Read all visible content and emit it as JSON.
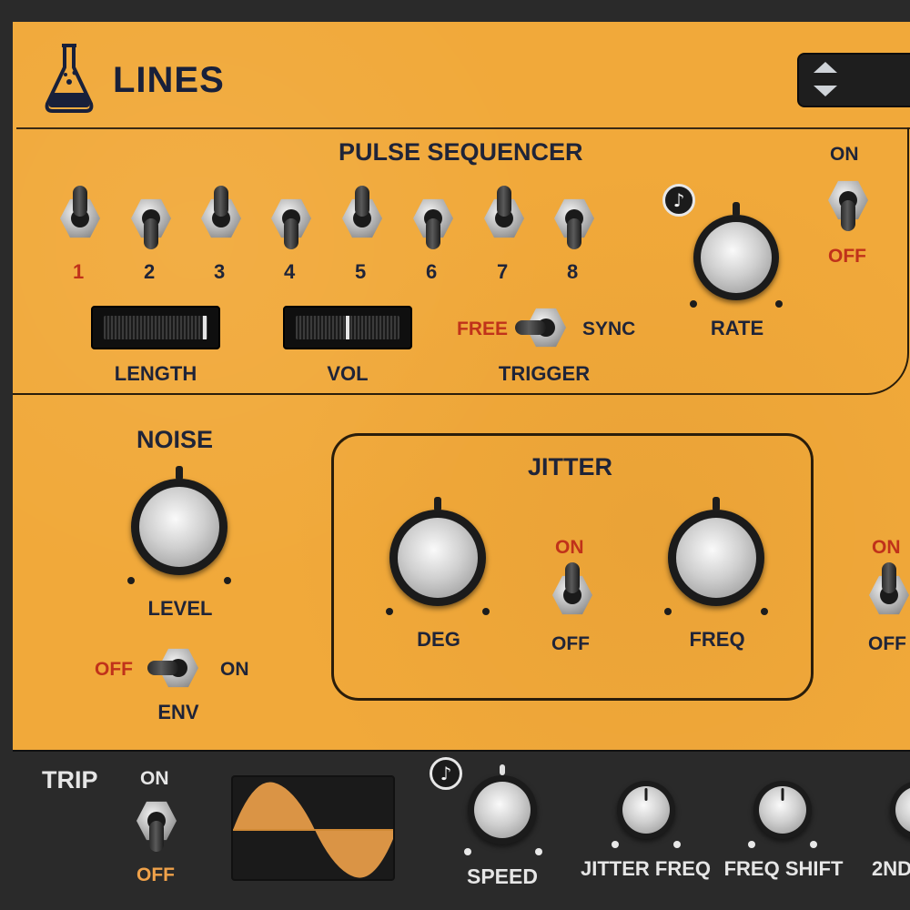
{
  "header": {
    "title": "LINES",
    "icon": "flask-icon"
  },
  "pulse_sequencer": {
    "title": "PULSE SEQUENCER",
    "steps": [
      "1",
      "2",
      "3",
      "4",
      "5",
      "6",
      "7",
      "8"
    ],
    "step_states": [
      "up",
      "down",
      "up",
      "down",
      "up",
      "down",
      "up",
      "down"
    ],
    "length_label": "LENGTH",
    "length_value": 0.97,
    "vol_label": "VOL",
    "vol_value": 0.5,
    "trigger_label": "TRIGGER",
    "trigger_free": "FREE",
    "trigger_sync": "SYNC",
    "rate_label": "RATE",
    "power_on": "ON",
    "power_off": "OFF"
  },
  "noise": {
    "title": "NOISE",
    "level_label": "LEVEL",
    "env_label": "ENV",
    "env_off": "OFF",
    "env_on": "ON"
  },
  "jitter": {
    "title": "JITTER",
    "deg_label": "DEG",
    "freq_label": "FREQ",
    "switch_on": "ON",
    "switch_off": "OFF"
  },
  "right_switch": {
    "on": "ON",
    "off": "OFF"
  },
  "trip": {
    "title": "TRIP",
    "on": "ON",
    "off": "OFF",
    "speed_label": "SPEED",
    "jitter_freq_label": "JITTER FREQ",
    "freq_shift_label": "FREQ SHIFT",
    "second_label": "2ND"
  },
  "colors": {
    "panel": "#f1a93a",
    "text_dark": "#1f2438",
    "text_red": "#c0321a",
    "bottom_bar": "#2a2a2a",
    "wave_fill": "#f0a24a"
  }
}
